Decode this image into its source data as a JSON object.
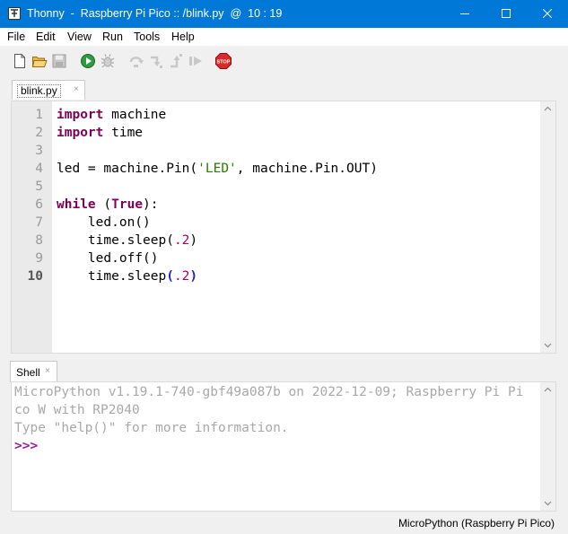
{
  "window": {
    "title": "Thonny  -  Raspberry Pi Pico :: /blink.py  @  10 : 19",
    "titlebar_color": "#0078d7"
  },
  "menu": [
    "File",
    "Edit",
    "View",
    "Run",
    "Tools",
    "Help"
  ],
  "toolbar": {
    "icons": [
      "new-file-icon",
      "open-file-icon",
      "save-icon",
      "run-icon",
      "debug-icon",
      "step-over-icon",
      "step-into-icon",
      "step-out-icon",
      "resume-icon",
      "stop-icon"
    ],
    "stop_label": "STOP"
  },
  "editor": {
    "tab_label": "blink.py",
    "tab_close": "×",
    "line_numbers": [
      "1",
      "2",
      "3",
      "4",
      "5",
      "6",
      "7",
      "8",
      "9",
      "10"
    ],
    "current_line": "10"
  },
  "code": {
    "l1_kw": "import",
    "l1_rest": " machine",
    "l2_kw": "import",
    "l2_rest": " time",
    "l4_a": "led = machine.Pin(",
    "l4_str": "'LED'",
    "l4_b": ", machine.Pin.OUT)",
    "l6_kw": "while",
    "l6_a": " (",
    "l6_true": "True",
    "l6_b": "):",
    "l7": "    led.on()",
    "l8_a": "    time.sleep(",
    "l8_num": ".2",
    "l8_b": ")",
    "l9": "    led.off()",
    "l10_a": "    time.sleep",
    "l10_open": "(",
    "l10_num": ".2",
    "l10_close": ")"
  },
  "shell": {
    "tab_label": "Shell",
    "tab_close": "×",
    "lines": [
      "MicroPython v1.19.1-740-gbf49a087b on 2022-12-09; Raspberry Pi Pi",
      "co W with RP2040",
      "Type \"help()\" for more information."
    ],
    "prompt": ">>>"
  },
  "status": {
    "interpreter": "MicroPython (Raspberry Pi Pico)"
  },
  "colors": {
    "keyword": "#7f0055",
    "string": "#2a7a00",
    "number": "#b5005a",
    "prompt": "#9b1ba0",
    "shell_text": "#a8a8a8"
  }
}
